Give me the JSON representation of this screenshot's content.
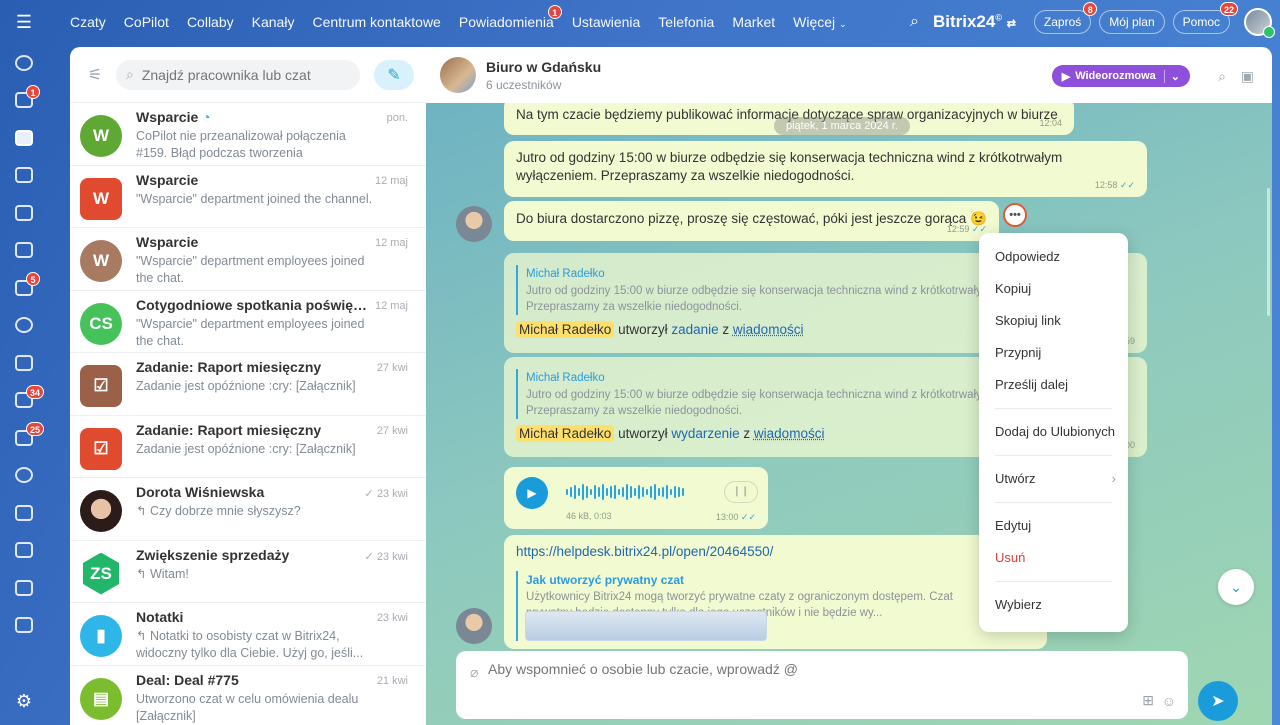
{
  "topnav": {
    "items": [
      {
        "label": "Czaty",
        "badge": ""
      },
      {
        "label": "CoPilot",
        "badge": ""
      },
      {
        "label": "Collaby",
        "badge": ""
      },
      {
        "label": "Kanały",
        "badge": ""
      },
      {
        "label": "Centrum kontaktowe",
        "badge": ""
      },
      {
        "label": "Powiadomienia",
        "badge": "1"
      },
      {
        "label": "Ustawienia",
        "badge": ""
      },
      {
        "label": "Telefonia",
        "badge": ""
      },
      {
        "label": "Market",
        "badge": ""
      },
      {
        "label": "Więcej",
        "badge": ""
      }
    ],
    "brand": "Bitrix24",
    "brand_mark": "©",
    "invite_label": "Zaproś",
    "invite_badge": "8",
    "myplan_label": "Mój plan",
    "help_label": "Pomoc",
    "help_badge": "22"
  },
  "leftrail": {
    "items": [
      {
        "icon": "copilot-icon",
        "badge": ""
      },
      {
        "icon": "feed-icon",
        "badge": "1"
      },
      {
        "icon": "chat-icon",
        "badge": ""
      },
      {
        "icon": "calendar-icon",
        "badge": ""
      },
      {
        "icon": "document-icon",
        "badge": ""
      },
      {
        "icon": "drive-icon",
        "badge": ""
      },
      {
        "icon": "mail-icon",
        "badge": "5"
      },
      {
        "icon": "groups-icon",
        "badge": ""
      },
      {
        "icon": "board-icon",
        "badge": ""
      },
      {
        "icon": "tasks-icon",
        "badge": "34"
      },
      {
        "icon": "crm-icon",
        "badge": "25"
      },
      {
        "icon": "target-icon",
        "badge": ""
      },
      {
        "icon": "cart-icon",
        "badge": ""
      },
      {
        "icon": "inventory-icon",
        "badge": ""
      },
      {
        "icon": "shifts-icon",
        "badge": ""
      },
      {
        "icon": "analytics-icon",
        "badge": ""
      }
    ],
    "bottom_icon": "settings-icon"
  },
  "chatlist": {
    "search_placeholder": "Znajdź pracownika lub czat",
    "items": [
      {
        "name": "Wsparcie",
        "preview": "CoPilot nie przeanalizował połączenia #159. Błąd podczas tworzenia transkrypcji...",
        "date": "pon.",
        "avatar_text": "W",
        "avatar_color": "#5fa833"
      },
      {
        "name": "Wsparcie",
        "preview": "\"Wsparcie\" department joined the channel.",
        "date": "12 maj",
        "avatar_text": "W",
        "avatar_color": "#e04b2f"
      },
      {
        "name": "Wsparcie",
        "preview": "\"Wsparcie\" department employees joined the chat.",
        "date": "12 maj",
        "avatar_text": "W",
        "avatar_color": "#a87a62"
      },
      {
        "name": "Cotygodniowe spotkania poświęcon...",
        "preview": "\"Wsparcie\" department employees joined the chat.",
        "date": "12 maj",
        "avatar_text": "CS",
        "avatar_color": "#45c25a"
      },
      {
        "name": "Zadanie: Raport miesięczny",
        "preview": "Zadanie jest opóźnione :cry: [Załącznik]",
        "date": "27 kwi",
        "avatar_text": "☑",
        "avatar_color": "#9a6048"
      },
      {
        "name": "Zadanie: Raport miesięczny",
        "preview": "Zadanie jest opóźnione :cry: [Załącznik]",
        "date": "27 kwi",
        "avatar_text": "☑",
        "avatar_color": "#e04b2f"
      },
      {
        "name": "Dorota Wiśniewska",
        "preview": "↰ Czy dobrze mnie słyszysz?",
        "date": "✓ 23 kwi",
        "avatar_text": "",
        "avatar_color": "#3a2a28"
      },
      {
        "name": "Zwiększenie sprzedaży",
        "preview": "↰ Witam!",
        "date": "✓ 23 kwi",
        "avatar_text": "ZS",
        "avatar_color": "#22b66a"
      },
      {
        "name": "Notatki",
        "preview": "↰ Notatki to osobisty czat w Bitrix24, widoczny tylko dla Ciebie. Użyj go, jeśli...",
        "date": "23 kwi",
        "avatar_text": "▮",
        "avatar_color": "#2fb6e8"
      },
      {
        "name": "Deal: Deal #775",
        "preview": "Utworzono czat w celu omówienia dealu [Załącznik]",
        "date": "21 kwi",
        "avatar_text": "▤",
        "avatar_color": "#7bbd2e"
      }
    ]
  },
  "conversation": {
    "title": "Biuro w Gdańsku",
    "subtitle": "6 uczestników",
    "video_label": "Wideorozmowa",
    "date_chip": "piątek, 1 marca 2024 r.",
    "msg1": {
      "text": "Na tym czacie będziemy publikować informacje dotyczące spraw organizacyjnych w biurze",
      "time": "12:04"
    },
    "msg2": {
      "text": "Jutro od godziny 15:00 w biurze odbędzie się konserwacja techniczna wind z krótkotrwałym wyłączeniem. Przepraszamy za wszelkie niedogodności.",
      "time": "12:58"
    },
    "msg3": {
      "text": "Do biura dostarczono pizzę, proszę się częstować, póki jest jeszcze gorąca 😉",
      "time": "12:59"
    },
    "msg4": {
      "quote_name": "Michał Radełko",
      "quote_text": "Jutro od godziny 15:00 w biurze odbędzie się konserwacja techniczna wind z krótkotrwałym wyłączeniem. Przepraszamy za wszelkie niedogodności.",
      "mention": "Michał Radełko",
      "verb": "utworzył",
      "obj": "zadanie",
      "prep": "z",
      "link": "wiadomości",
      "time": "59"
    },
    "msg5": {
      "quote_name": "Michał Radełko",
      "quote_text": "Jutro od godziny 15:00 w biurze odbędzie się konserwacja techniczna wind z krótkotrwałym wyłączeniem. Przepraszamy za wszelkie niedogodności.",
      "mention": "Michał Radełko",
      "verb": "utworzył",
      "obj": "wydarzenie",
      "prep": "z",
      "link": "wiadomości",
      "time": "00"
    },
    "audio": {
      "size": "46 kB, 0:03",
      "time": "13:00"
    },
    "msg7": {
      "url": "https://helpdesk.bitrix24.pl/open/20464550/",
      "preview_title": "Jak utworzyć prywatny czat",
      "preview_text": "Użytkownicy Bitrix24 mogą tworzyć prywatne czaty z ograniczonym dostępem. Czat prywatny będzie dostępny tylko dla jego uczestników i nie będzie wy..."
    },
    "input_placeholder": "Aby wspomnieć o osobie lub czacie, wprowadź @"
  },
  "context_menu": {
    "items": [
      "Odpowiedz",
      "Kopiuj",
      "Skopiuj link",
      "Przypnij",
      "Prześlij dalej",
      "Dodaj do Ulubionych",
      "Utwórz",
      "Edytuj",
      "Usuń",
      "Wybierz"
    ]
  },
  "colors": {
    "accent": "#1a9cdb",
    "video": "#8e4fdb",
    "danger": "#e43b34",
    "bubble": "#f1fad0"
  }
}
